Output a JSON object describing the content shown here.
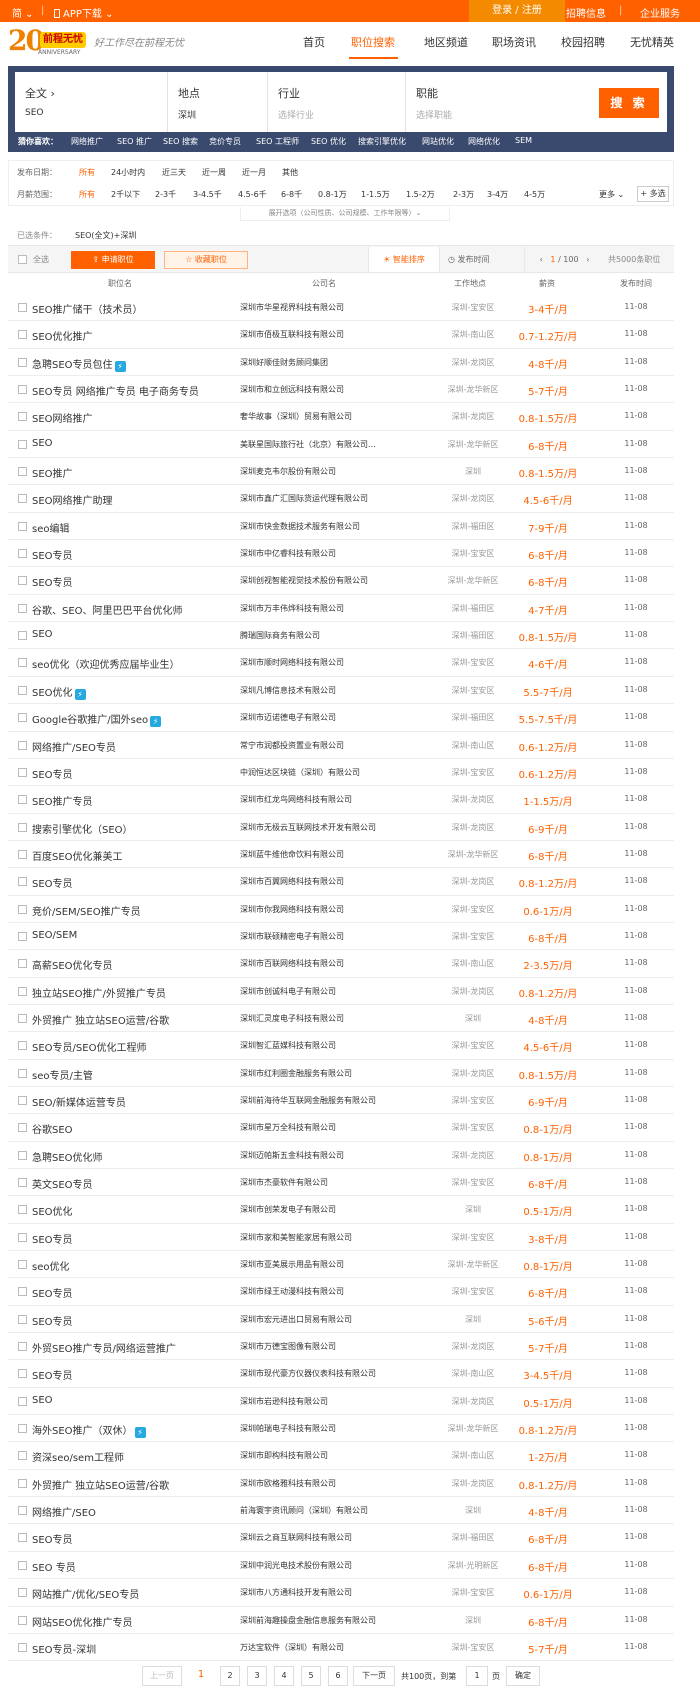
{
  "topbar": {
    "lang": "简 ⌄",
    "app": "APP下载 ⌄",
    "login": "登录 / 注册",
    "recruit": "招聘信息",
    "enterprise": "企业服务"
  },
  "logo": {
    "twenty": "20",
    "badge": "前程无忧",
    "anniversary": "ANNIVERSARY",
    "slogan": "好工作尽在前程无忧"
  },
  "nav": [
    "首页",
    "职位搜索",
    "地区频道",
    "职场资讯",
    "校园招聘",
    "无忧精英"
  ],
  "search": {
    "fields": [
      {
        "label": "全文 ›",
        "value": "SEO",
        "placeholder": false
      },
      {
        "label": "地点",
        "value": "深圳",
        "placeholder": false
      },
      {
        "label": "行业",
        "value": "选择行业",
        "placeholder": true
      },
      {
        "label": "职能",
        "value": "选择职能",
        "placeholder": true
      }
    ],
    "button": "搜 索",
    "guess_title": "猜你喜欢：",
    "guess_keywords": [
      "网络推广",
      "SEO 推广",
      "SEO 搜索",
      "竞价专员",
      "SEO 工程师",
      "SEO 优化",
      "搜索引擎优化",
      "网站优化",
      "网络优化",
      "SEM"
    ]
  },
  "filters": {
    "date_label": "发布日期：",
    "date_options": [
      "所有",
      "24小时内",
      "近三天",
      "近一周",
      "近一月",
      "其他"
    ],
    "salary_label": "月薪范围：",
    "salary_options": [
      "所有",
      "2千以下",
      "2-3千",
      "3-4.5千",
      "4.5-6千",
      "6-8千",
      "0.8-1万",
      "1-1.5万",
      "1.5-2万",
      "2-3万",
      "3-4万",
      "4-5万"
    ],
    "more": "更多 ⌄",
    "multi": "+ 多选",
    "expand": "展开选项（公司性质、公司规模、工作年限等）⌄"
  },
  "selected": {
    "label": "已选条件：",
    "value": "SEO(全文)+深圳"
  },
  "actions": {
    "all": "全选",
    "apply": "申请职位",
    "favorite": "收藏职位",
    "smart_sort": "智能排序",
    "pub_time": "发布时间",
    "page_current": "1",
    "page_total": "/ 100",
    "total": "共5000条职位"
  },
  "table": {
    "headers": [
      "职位名",
      "公司名",
      "工作地点",
      "薪资",
      "发布时间"
    ],
    "rows": [
      {
        "title": "SEO推广储干（技术员）",
        "company": "深圳市华星视界科技有限公司",
        "loc": "深圳-宝安区",
        "salary": "3-4千/月",
        "date": "11-08",
        "bolt": false
      },
      {
        "title": "SEO优化推广",
        "company": "深圳市佰极互联科技有限公司",
        "loc": "深圳-南山区",
        "salary": "0.7-1.2万/月",
        "date": "11-08",
        "bolt": false
      },
      {
        "title": "急聘SEO专员包住",
        "company": "深圳好顺佳财务顾问集团",
        "loc": "深圳-龙岗区",
        "salary": "4-8千/月",
        "date": "11-08",
        "bolt": true
      },
      {
        "title": "SEO专员 网络推广专员 电子商务专员",
        "company": "深圳市和立创远科技有限公司",
        "loc": "深圳-龙华新区",
        "salary": "5-7千/月",
        "date": "11-08",
        "bolt": false
      },
      {
        "title": "SEO网络推广",
        "company": "奢华故事（深圳）贸易有限公司",
        "loc": "深圳-龙岗区",
        "salary": "0.8-1.5万/月",
        "date": "11-08",
        "bolt": false
      },
      {
        "title": "SEO",
        "company": "美联星国际旅行社（北京）有限公司...",
        "loc": "深圳-龙华新区",
        "salary": "6-8千/月",
        "date": "11-08",
        "bolt": false
      },
      {
        "title": "SEO推广",
        "company": "深圳麦克韦尔股份有限公司",
        "loc": "深圳",
        "salary": "0.8-1.5万/月",
        "date": "11-08",
        "bolt": false
      },
      {
        "title": "SEO网络推广助理",
        "company": "深圳市鑫广汇国际货运代理有限公司",
        "loc": "深圳-龙岗区",
        "salary": "4.5-6千/月",
        "date": "11-08",
        "bolt": false
      },
      {
        "title": "seo编辑",
        "company": "深圳市快金数据技术服务有限公司",
        "loc": "深圳-福田区",
        "salary": "7-9千/月",
        "date": "11-08",
        "bolt": false
      },
      {
        "title": "SEO专员",
        "company": "深圳市中亿睿科技有限公司",
        "loc": "深圳-宝安区",
        "salary": "6-8千/月",
        "date": "11-08",
        "bolt": false
      },
      {
        "title": "SEO专员",
        "company": "深圳创视智能视觉技术股份有限公司",
        "loc": "深圳-龙华新区",
        "salary": "6-8千/月",
        "date": "11-08",
        "bolt": false
      },
      {
        "title": "谷歌、SEO、阿里巴巴平台优化师",
        "company": "深圳市万丰伟烨科技有限公司",
        "loc": "深圳-福田区",
        "salary": "4-7千/月",
        "date": "11-08",
        "bolt": false
      },
      {
        "title": "SEO",
        "company": "腾瑞国际商务有限公司",
        "loc": "深圳-福田区",
        "salary": "0.8-1.5万/月",
        "date": "11-08",
        "bolt": false
      },
      {
        "title": "seo优化（欢迎优秀应届毕业生）",
        "company": "深圳市顺时网络科技有限公司",
        "loc": "深圳-宝安区",
        "salary": "4-6千/月",
        "date": "11-08",
        "bolt": false
      },
      {
        "title": "SEO优化",
        "company": "深圳凡博信息技术有限公司",
        "loc": "深圳-宝安区",
        "salary": "5.5-7千/月",
        "date": "11-08",
        "bolt": true
      },
      {
        "title": "Google谷歌推广/国外seo",
        "company": "深圳市迈诺德电子有限公司",
        "loc": "深圳-福田区",
        "salary": "5.5-7.5千/月",
        "date": "11-08",
        "bolt": true
      },
      {
        "title": "网络推广/SEO专员",
        "company": "常宁市润都投资置业有限公司",
        "loc": "深圳-南山区",
        "salary": "0.6-1.2万/月",
        "date": "11-08",
        "bolt": false
      },
      {
        "title": "SEO专员",
        "company": "中润恒达区块链（深圳）有限公司",
        "loc": "深圳-宝安区",
        "salary": "0.6-1.2万/月",
        "date": "11-08",
        "bolt": false
      },
      {
        "title": "SEO推广专员",
        "company": "深圳市红龙鸟网络科技有限公司",
        "loc": "深圳-龙岗区",
        "salary": "1-1.5万/月",
        "date": "11-08",
        "bolt": false
      },
      {
        "title": "搜索引擎优化（SEO）",
        "company": "深圳市无极云互联网技术开发有限公司",
        "loc": "深圳-龙岗区",
        "salary": "6-9千/月",
        "date": "11-08",
        "bolt": false
      },
      {
        "title": "百度SEO优化兼美工",
        "company": "深圳蓝牛维他命饮料有限公司",
        "loc": "深圳-龙华新区",
        "salary": "6-8千/月",
        "date": "11-08",
        "bolt": false
      },
      {
        "title": "SEO专员",
        "company": "深圳市百翼网络科技有限公司",
        "loc": "深圳-龙岗区",
        "salary": "0.8-1.2万/月",
        "date": "11-08",
        "bolt": false
      },
      {
        "title": "竞价/SEM/SEO推广专员",
        "company": "深圳市你我网络科技有限公司",
        "loc": "深圳-宝安区",
        "salary": "0.6-1万/月",
        "date": "11-08",
        "bolt": false
      },
      {
        "title": "SEO/SEM",
        "company": "深圳市联硕精密电子有限公司",
        "loc": "深圳-宝安区",
        "salary": "6-8千/月",
        "date": "11-08",
        "bolt": false
      },
      {
        "title": "高薪SEO优化专员",
        "company": "深圳市百联网络科技有限公司",
        "loc": "深圳-南山区",
        "salary": "2-3.5万/月",
        "date": "11-08",
        "bolt": false
      },
      {
        "title": "独立站SEO推广/外贸推广专员",
        "company": "深圳市创诚科电子有限公司",
        "loc": "深圳-龙岗区",
        "salary": "0.8-1.2万/月",
        "date": "11-08",
        "bolt": false
      },
      {
        "title": "外贸推广 独立站SEO运营/谷歌",
        "company": "深圳汇灵度电子科技有限公司",
        "loc": "深圳",
        "salary": "4-8千/月",
        "date": "11-08",
        "bolt": false
      },
      {
        "title": "SEO专员/SEO优化工程师",
        "company": "深圳智汇蓝媒科技有限公司",
        "loc": "深圳-宝安区",
        "salary": "4.5-6千/月",
        "date": "11-08",
        "bolt": false
      },
      {
        "title": "seo专员/主管",
        "company": "深圳市红利圈金融服务有限公司",
        "loc": "深圳-龙岗区",
        "salary": "0.8-1.5万/月",
        "date": "11-08",
        "bolt": false
      },
      {
        "title": "SEO/新媒体运营专员",
        "company": "深圳前海待华互联网金融服务有限公司",
        "loc": "深圳-宝安区",
        "salary": "6-9千/月",
        "date": "11-08",
        "bolt": false
      },
      {
        "title": "谷歌SEO",
        "company": "深圳市星万全科技有限公司",
        "loc": "深圳-宝安区",
        "salary": "0.8-1万/月",
        "date": "11-08",
        "bolt": false
      },
      {
        "title": "急聘SEO优化师",
        "company": "深圳迈帕斯五金科技有限公司",
        "loc": "深圳-龙岗区",
        "salary": "0.8-1万/月",
        "date": "11-08",
        "bolt": false
      },
      {
        "title": "英文SEO专员",
        "company": "深圳市杰豪软件有限公司",
        "loc": "深圳-宝安区",
        "salary": "6-8千/月",
        "date": "11-08",
        "bolt": false
      },
      {
        "title": "SEO优化",
        "company": "深圳市创荣发电子有限公司",
        "loc": "深圳",
        "salary": "0.5-1万/月",
        "date": "11-08",
        "bolt": false
      },
      {
        "title": "SEO专员",
        "company": "深圳市家和美智能家居有限公司",
        "loc": "深圳-宝安区",
        "salary": "3-8千/月",
        "date": "11-08",
        "bolt": false
      },
      {
        "title": "seo优化",
        "company": "深圳市亚美展示用品有限公司",
        "loc": "深圳-龙华新区",
        "salary": "0.8-1万/月",
        "date": "11-08",
        "bolt": false
      },
      {
        "title": "SEO专员",
        "company": "深圳市绿王动漫科技有限公司",
        "loc": "深圳-宝安区",
        "salary": "6-8千/月",
        "date": "11-08",
        "bolt": false
      },
      {
        "title": "SEO专员",
        "company": "深圳市宏元进出口贸易有限公司",
        "loc": "深圳",
        "salary": "5-6千/月",
        "date": "11-08",
        "bolt": false
      },
      {
        "title": "外贸SEO推广专员/网络运营推广",
        "company": "深圳市万德宝图像有限公司",
        "loc": "深圳-龙岗区",
        "salary": "5-7千/月",
        "date": "11-08",
        "bolt": false
      },
      {
        "title": "SEO专员",
        "company": "深圳市现代豪方仪器仪表科技有限公司",
        "loc": "深圳-南山区",
        "salary": "3-4.5千/月",
        "date": "11-08",
        "bolt": false
      },
      {
        "title": "SEO",
        "company": "深圳市岩逊科技有限公司",
        "loc": "深圳-龙岗区",
        "salary": "0.5-1万/月",
        "date": "11-08",
        "bolt": false
      },
      {
        "title": "海外SEO推广（双休）",
        "company": "深圳帕瑞电子科技有限公司",
        "loc": "深圳-龙华新区",
        "salary": "0.8-1.2万/月",
        "date": "11-08",
        "bolt": true
      },
      {
        "title": "资深seo/sem工程师",
        "company": "深圳市即构科技有限公司",
        "loc": "深圳-南山区",
        "salary": "1-2万/月",
        "date": "11-08",
        "bolt": false
      },
      {
        "title": "外贸推广 独立站SEO运营/谷歌",
        "company": "深圳市欧格雅科技有限公司",
        "loc": "深圳-龙岗区",
        "salary": "0.8-1.2万/月",
        "date": "11-08",
        "bolt": false
      },
      {
        "title": "网络推广/SEO",
        "company": "前海寰宇资讯顾问（深圳）有限公司",
        "loc": "深圳",
        "salary": "4-8千/月",
        "date": "11-08",
        "bolt": false
      },
      {
        "title": "SEO专员",
        "company": "深圳云之商互联网科技有限公司",
        "loc": "深圳-福田区",
        "salary": "6-8千/月",
        "date": "11-08",
        "bolt": false
      },
      {
        "title": "SEO 专员",
        "company": "深圳中润光电技术股份有限公司",
        "loc": "深圳-光明新区",
        "salary": "6-8千/月",
        "date": "11-08",
        "bolt": false
      },
      {
        "title": "网站推广/优化/SEO专员",
        "company": "深圳市八方通科技开发有限公司",
        "loc": "深圳-宝安区",
        "salary": "0.6-1万/月",
        "date": "11-08",
        "bolt": false
      },
      {
        "title": "网站SEO优化推广专员",
        "company": "深圳前海趣操盘金融信息服务有限公司",
        "loc": "深圳",
        "salary": "6-8千/月",
        "date": "11-08",
        "bolt": false
      },
      {
        "title": "SEO专员-深圳",
        "company": "万达宝软件（深圳）有限公司",
        "loc": "深圳-宝安区",
        "salary": "5-7千/月",
        "date": "11-08",
        "bolt": false
      }
    ]
  },
  "pagination": {
    "prev": "上一页",
    "pages": [
      "1",
      "2",
      "3",
      "4",
      "5",
      "6"
    ],
    "next": "下一页",
    "total_pages": "共100页，到第",
    "goto_value": "1",
    "page_unit": "页",
    "confirm": "确定"
  },
  "colors": {
    "brand": "#ff6000",
    "search_panel": "#3a4a6e",
    "bolt": "#26a8e0"
  }
}
